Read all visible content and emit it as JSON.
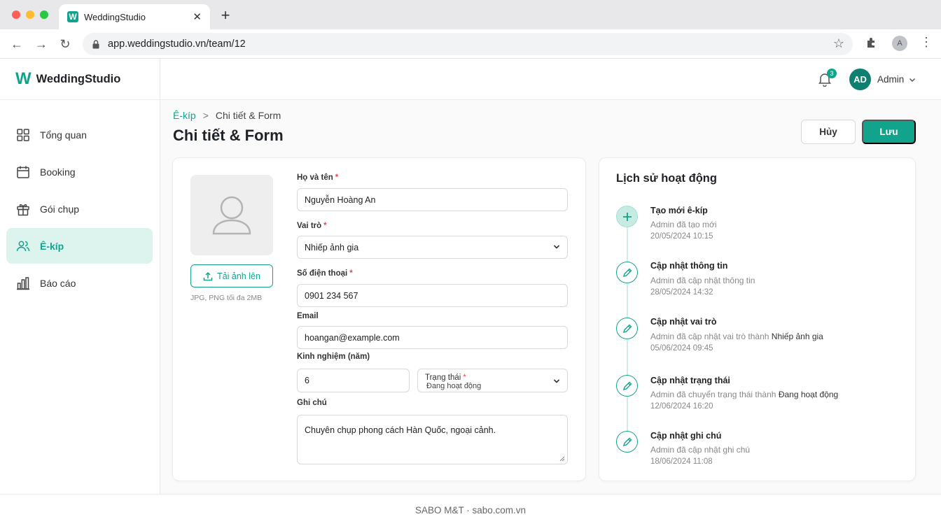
{
  "browser": {
    "tab_title": "WeddingStudio",
    "tab_icon": "W",
    "url": "app.weddingstudio.vn/team/12",
    "profile_initial": "A"
  },
  "brand": {
    "logo": "W",
    "name": "WeddingStudio",
    "accent": "#12a38c"
  },
  "sidebar": {
    "items": [
      {
        "label": "Tổng quan",
        "icon": "grid-icon",
        "active": false
      },
      {
        "label": "Booking",
        "icon": "calendar-icon",
        "active": false
      },
      {
        "label": "Gói chụp",
        "icon": "gift-icon",
        "active": false
      },
      {
        "label": "Ê-kíp",
        "icon": "users-icon",
        "active": true
      },
      {
        "label": "Báo cáo",
        "icon": "bar-chart-icon",
        "active": false
      }
    ]
  },
  "header": {
    "notifications": "3",
    "avatar_initials": "AD",
    "user_name": "Admin"
  },
  "breadcrumb": {
    "parent": "Ê-kíp",
    "separator": ">",
    "current": "Chi tiết & Form"
  },
  "page": {
    "title": "Chi tiết & Form",
    "cancel_label": "Hủy",
    "save_label": "Lưu"
  },
  "form": {
    "upload_label": "Tải ảnh lên",
    "upload_hint": "JPG, PNG tối đa 2MB",
    "required_mark": "*",
    "name_label": "Họ và tên",
    "name_value": "Nguyễn Hoàng An",
    "role_label": "Vai trò",
    "role_value": "Nhiếp ảnh gia",
    "phone_label": "Số điện thoại",
    "phone_value": "0901 234 567",
    "email_label": "Email",
    "email_value": "hoangan@example.com",
    "experience_label": "Kinh nghiệm (năm)",
    "experience_value": "6",
    "status_label": "Trạng thái",
    "status_value": "Đang hoạt động",
    "notes_label": "Ghi chú",
    "notes_value": "Chuyên chụp phong cách Hàn Quốc, ngoại cảnh."
  },
  "history": {
    "title": "Lịch sử hoạt động",
    "events": [
      {
        "icon": "plus-icon",
        "title": "Tạo mới ê-kíp",
        "desc": "Admin đã tạo mới",
        "highlight": "",
        "time": "20/05/2024 10:15"
      },
      {
        "icon": "pencil-icon",
        "title": "Cập nhật thông tin",
        "desc": "Admin đã cập nhật thông tin",
        "highlight": "",
        "time": "28/05/2024 14:32"
      },
      {
        "icon": "pencil-icon",
        "title": "Cập nhật vai trò",
        "desc": "Admin đã cập nhật vai trò thành",
        "highlight": "Nhiếp ảnh gia",
        "time": "05/06/2024 09:45"
      },
      {
        "icon": "pencil-icon",
        "title": "Cập nhật trạng thái",
        "desc": "Admin đã chuyển trạng thái thành",
        "highlight": "Đang hoạt động",
        "time": "12/06/2024 16:20"
      },
      {
        "icon": "pencil-icon",
        "title": "Cập nhật ghi chú",
        "desc": "Admin đã cập nhật ghi chú",
        "highlight": "",
        "time": "18/06/2024 11:08"
      }
    ]
  },
  "footer": {
    "text": "SABO M&T · sabo.com.vn"
  }
}
